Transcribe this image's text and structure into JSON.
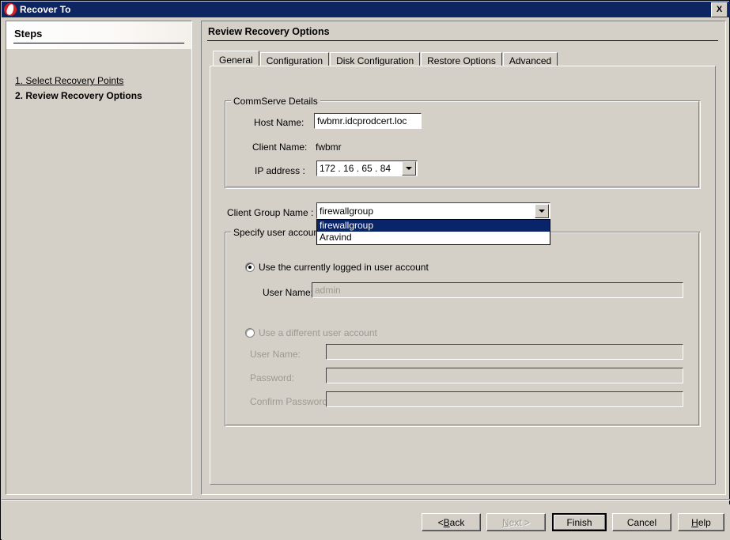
{
  "window": {
    "title": "Recover To",
    "icon": "commvault-logo-icon",
    "close_label": "X"
  },
  "sidebar": {
    "heading": "Steps",
    "items": [
      {
        "label": "1. Select Recovery Points",
        "state": "link"
      },
      {
        "label": "2. Review Recovery Options",
        "state": "current"
      }
    ]
  },
  "content": {
    "title": "Review Recovery Options",
    "tabs": [
      {
        "label": "General",
        "active": true
      },
      {
        "label": "Configuration",
        "active": false
      },
      {
        "label": "Disk Configuration",
        "active": false
      },
      {
        "label": "Restore Options",
        "active": false
      },
      {
        "label": "Advanced",
        "active": false
      }
    ],
    "commserve": {
      "group_label": "CommServe Details",
      "host_name_label": "Host Name:",
      "host_name_value": "fwbmr.idcprodcert.loc",
      "client_name_label": "Client Name:",
      "client_name_value": "fwbmr",
      "ip_label": "IP address :",
      "ip_value": "172 . 16  . 65  . 84"
    },
    "client_group": {
      "label": "Client Group Name :",
      "selected": "firewallgroup",
      "options": [
        {
          "label": "firewallgroup",
          "selected": true
        },
        {
          "label": "Aravind",
          "selected": false
        }
      ],
      "expanded": true
    },
    "user_account": {
      "group_label": "Specify user account",
      "option_current": "Use the currently logged in user account",
      "option_current_checked": true,
      "current_user_label": "User Name:",
      "current_user_value": "admin",
      "option_different": "Use a different user account",
      "option_different_checked": false,
      "different_user_label": "User Name:",
      "different_user_value": "",
      "password_label": "Password:",
      "password_value": "",
      "confirm_password_label": "Confirm Password:",
      "confirm_password_value": ""
    }
  },
  "footer": {
    "back": {
      "pre": "< ",
      "accel": "B",
      "post": "ack",
      "enabled": true
    },
    "next": {
      "pre": "",
      "accel": "N",
      "post": "ext >",
      "enabled": false
    },
    "finish": {
      "label": "Finish",
      "enabled": true,
      "default": true
    },
    "cancel": {
      "label": "Cancel",
      "enabled": true
    },
    "help": {
      "pre": "",
      "accel": "H",
      "post": "elp",
      "enabled": true
    }
  },
  "colors": {
    "titlebar": "#0d2560",
    "face": "#d4d0c8",
    "highlight": "#0a246a",
    "brand_red": "#d81f26",
    "disabled_text": "#9a9a92"
  }
}
